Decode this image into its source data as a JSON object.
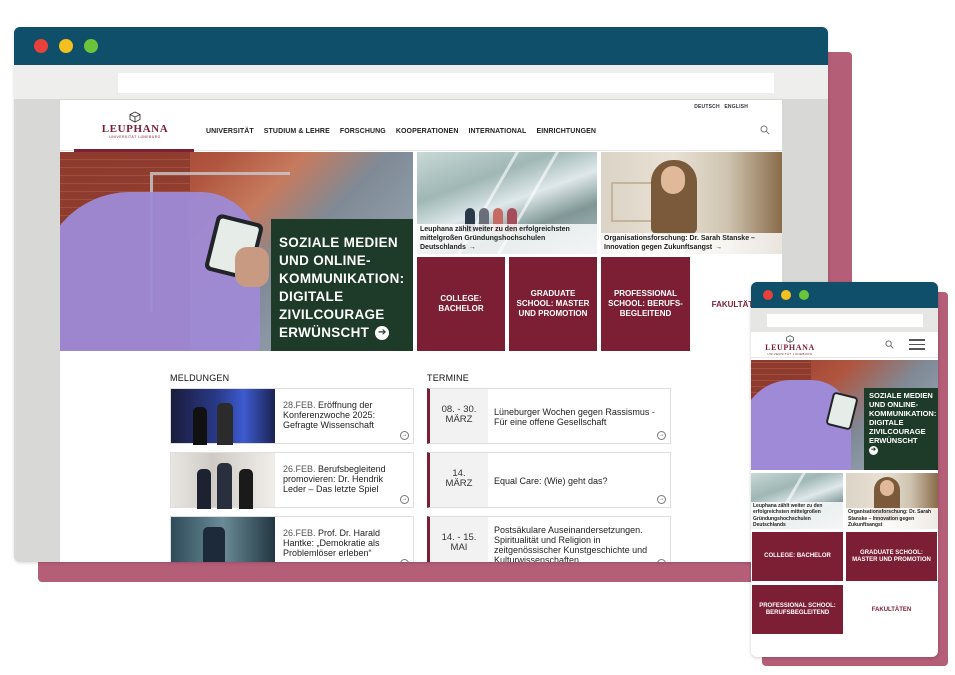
{
  "desktop": {
    "language_links": [
      "DEUTSCH",
      "ENGLISH"
    ],
    "logo": {
      "wordmark": "LEUPHANA",
      "subline": "UNIVERSITÄT LÜNEBURG"
    },
    "nav": [
      "UNIVERSITÄT",
      "STUDIUM & LEHRE",
      "FORSCHUNG",
      "KOOPERATIONEN",
      "INTERNATIONAL",
      "EINRICHTUNGEN"
    ],
    "hero": {
      "headline": "SOZIALE MEDIEN UND ONLINE-KOMMUNIKATION: DIGITALE ZIVILCOURAGE ERWÜNSCHT"
    },
    "tiles": {
      "news_a": "Leuphana zählt weiter zu den erfolgreichsten mittelgroßen Gründungshochschulen Deutschlands",
      "news_b": "Organisationsforschung: Dr. Sarah Stanske – Innovation gegen Zukunftsangst",
      "college": "COLLEGE: BACHELOR",
      "graduate": "GRADUATE SCHOOL: MASTER UND PROMOTION",
      "professional": "PROFESSIONAL SCHOOL: BERUFS-BEGLEITEND",
      "faculties": "FAKULTÄTEN"
    },
    "news_heading": "MELDUNGEN",
    "news": [
      {
        "date": "28.FEB.",
        "title": "Eröffnung der Konferenzwoche 2025: Gefragte Wissenschaft"
      },
      {
        "date": "26.FEB.",
        "title": "Berufsbegleitend promovieren: Dr. Hendrik Leder – Das letzte Spiel"
      },
      {
        "date": "26.FEB.",
        "title": "Prof. Dr. Harald Hantke: „Demokratie als Problemlöser erleben“"
      }
    ],
    "events_heading": "TERMINE",
    "events": [
      {
        "date_range": "08. - 30.",
        "month": "MÄRZ",
        "title": "Lüneburger Wochen gegen Rassismus - Für eine offene Gesellschaft"
      },
      {
        "date_range": "14.",
        "month": "MÄRZ",
        "title": "Equal Care: (Wie) geht das?"
      },
      {
        "date_range": "14. - 15.",
        "month": "MAI",
        "title": "Postsäkulare Auseinandersetzungen. Spiritualität und Religion in zeitgenössischer Kunstgeschichte und Kulturwissenschaften"
      }
    ]
  },
  "mobile": {
    "logo": {
      "wordmark": "LEUPHANA",
      "subline": "UNIVERSITÄT LÜNEBURG"
    },
    "hero_headline": "SOZIALE MEDIEN UND ONLINE-KOMMUNIKATION: DIGITALE ZIVILCOURAGE ERWÜNSCHT",
    "tile_a": "Leuphana zählt weiter zu den erfolgreichsten mittelgroßen Gründungshochschulen Deutschlands",
    "tile_b": "Organisationsforschung: Dr. Sarah Stanske – Innovation gegen Zukunftsangst",
    "college": "COLLEGE: BACHELOR",
    "graduate": "GRADUATE SCHOOL: MASTER UND PROMOTION",
    "professional": "PROFESSIONAL SCHOOL: BERUFSBEGLEITEND",
    "faculties": "FAKULTÄTEN"
  },
  "icons": {
    "arrow": "→",
    "circle_arrow": "➔"
  },
  "colors": {
    "brand_red": "#7c1e34",
    "window_bar": "#0f4f69",
    "shadow_pink": "#b45e78",
    "hero_green": "#1e3a28"
  }
}
